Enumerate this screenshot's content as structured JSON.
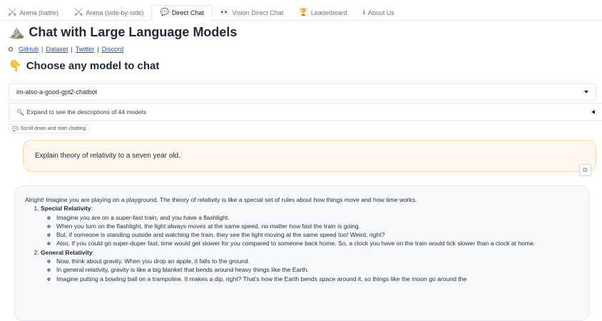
{
  "tabs": [
    {
      "icon": "⚔️",
      "icon_name": "crossed-swords-icon",
      "label": "Arena (battle)",
      "active": false
    },
    {
      "icon": "⚔️",
      "icon_name": "crossed-swords-icon",
      "label": "Arena (side-by-side)",
      "active": false
    },
    {
      "icon": "💬",
      "icon_name": "speech-bubble-icon",
      "label": "Direct Chat",
      "active": true
    },
    {
      "icon": "👀",
      "icon_name": "eyes-icon",
      "label": "Vision Direct Chat",
      "active": false
    },
    {
      "icon": "🏆",
      "icon_name": "trophy-icon",
      "label": "Leaderboard",
      "active": false
    },
    {
      "icon": "ℹ",
      "icon_name": "info-icon",
      "label": "About Us",
      "active": false
    }
  ],
  "header": {
    "title_icon": "⛰️",
    "title": "Chat with Large Language Models",
    "links": [
      "GitHub",
      "Dataset",
      "Twitter",
      "Discord"
    ],
    "link_separator": "|",
    "subtitle_icon": "👇",
    "subtitle": "Choose any model to chat"
  },
  "model_selector": {
    "selected": "im-also-a-good-gpt2-chatbot"
  },
  "models_accordion": {
    "icon": "🔍",
    "label": "Expand to see the descriptions of 44 models"
  },
  "chat_hint": {
    "icon": "💬",
    "label": "Scroll down and start chatting"
  },
  "conversation": {
    "user_message": "Explain theory of relativity to a seven year old.",
    "copy_icon": "⧉",
    "bot": {
      "intro": "Alright! Imagine you are playing on a playground. The theory of relativity is like a special set of rules about how things move and how time works.",
      "sections": [
        {
          "title": "Special Relativity",
          "colon": ":",
          "points": [
            "Imagine you are on a super-fast train, and you have a flashlight.",
            "When you turn on the flashlight, the light always moves at the same speed, no matter how fast the train is going.",
            "But, if someone is standing outside and watching the train, they see the light moving at the same speed too! Weird, right?",
            "Also, if you could go super-duper fast, time would get slower for you compared to someone back home. So, a clock you have on the train would tick slower than a clock at home."
          ]
        },
        {
          "title": "General Relativity",
          "colon": ":",
          "points": [
            "Now, think about gravity. When you drop an apple, it falls to the ground.",
            "In general relativity, gravity is like a big blanket that bends around heavy things like the Earth.",
            "Imagine putting a bowling ball on a trampoline. It makes a dip, right? That's how the Earth bends space around it, so things like the moon go around the"
          ]
        }
      ]
    }
  }
}
